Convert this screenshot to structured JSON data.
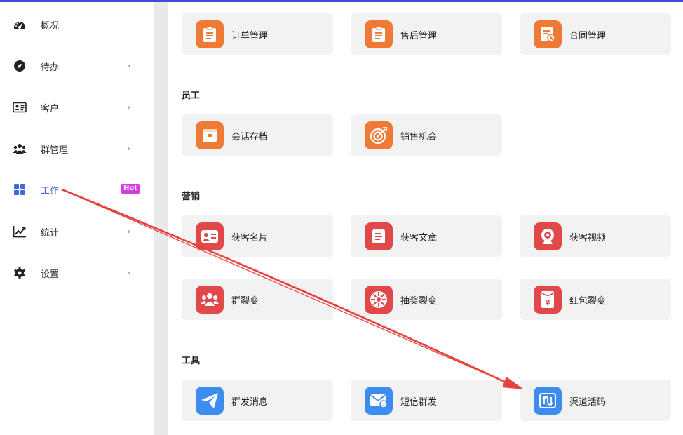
{
  "sidebar": {
    "items": [
      {
        "label": "概况",
        "icon": "dashboard-icon",
        "chevron": ""
      },
      {
        "label": "待办",
        "icon": "compass-icon",
        "chevron": "›"
      },
      {
        "label": "客户",
        "icon": "id-card-icon",
        "chevron": "›"
      },
      {
        "label": "群管理",
        "icon": "group-icon",
        "chevron": "›"
      },
      {
        "label": "工作",
        "icon": "grid-icon",
        "badge": "Hot",
        "active": true
      },
      {
        "label": "统计",
        "icon": "chart-line-icon",
        "chevron": "›"
      },
      {
        "label": "设置",
        "icon": "gear-icon",
        "chevron": "›"
      }
    ]
  },
  "sections": {
    "orders": {
      "items": [
        {
          "label": "订单管理",
          "icon": "clipboard-icon",
          "color": "#ee7a35"
        },
        {
          "label": "售后管理",
          "icon": "clipboard-icon",
          "color": "#ee7a35"
        },
        {
          "label": "合同管理",
          "icon": "contract-icon",
          "color": "#ee7a35"
        }
      ]
    },
    "staff": {
      "title": "员工",
      "items": [
        {
          "label": "会话存档",
          "icon": "archive-icon",
          "color": "#ee7a35"
        },
        {
          "label": "销售机会",
          "icon": "target-icon",
          "color": "#ee7a35"
        }
      ]
    },
    "marketing": {
      "title": "营销",
      "items": [
        {
          "label": "获客名片",
          "icon": "business-card-icon",
          "color": "#e0484a"
        },
        {
          "label": "获客文章",
          "icon": "article-icon",
          "color": "#e0484a"
        },
        {
          "label": "获客视频",
          "icon": "video-camera-icon",
          "color": "#e0484a"
        },
        {
          "label": "群裂变",
          "icon": "people-icon",
          "color": "#e0484a"
        },
        {
          "label": "抽奖裂变",
          "icon": "lottery-wheel-icon",
          "color": "#e0484a"
        },
        {
          "label": "红包裂变",
          "icon": "red-packet-icon",
          "color": "#e0484a"
        }
      ]
    },
    "tools": {
      "title": "工具",
      "items": [
        {
          "label": "群发消息",
          "icon": "paper-plane-icon",
          "color": "#3d8cf0"
        },
        {
          "label": "短信群发",
          "icon": "envelope-icon",
          "color": "#3d8cf0"
        },
        {
          "label": "渠道活码",
          "icon": "channel-code-icon",
          "color": "#3d8cf0"
        }
      ]
    }
  },
  "colors": {
    "accent": "#3f6ad8",
    "annotation_arrow": "#e8403c",
    "hot_badge": "#d63be0"
  }
}
